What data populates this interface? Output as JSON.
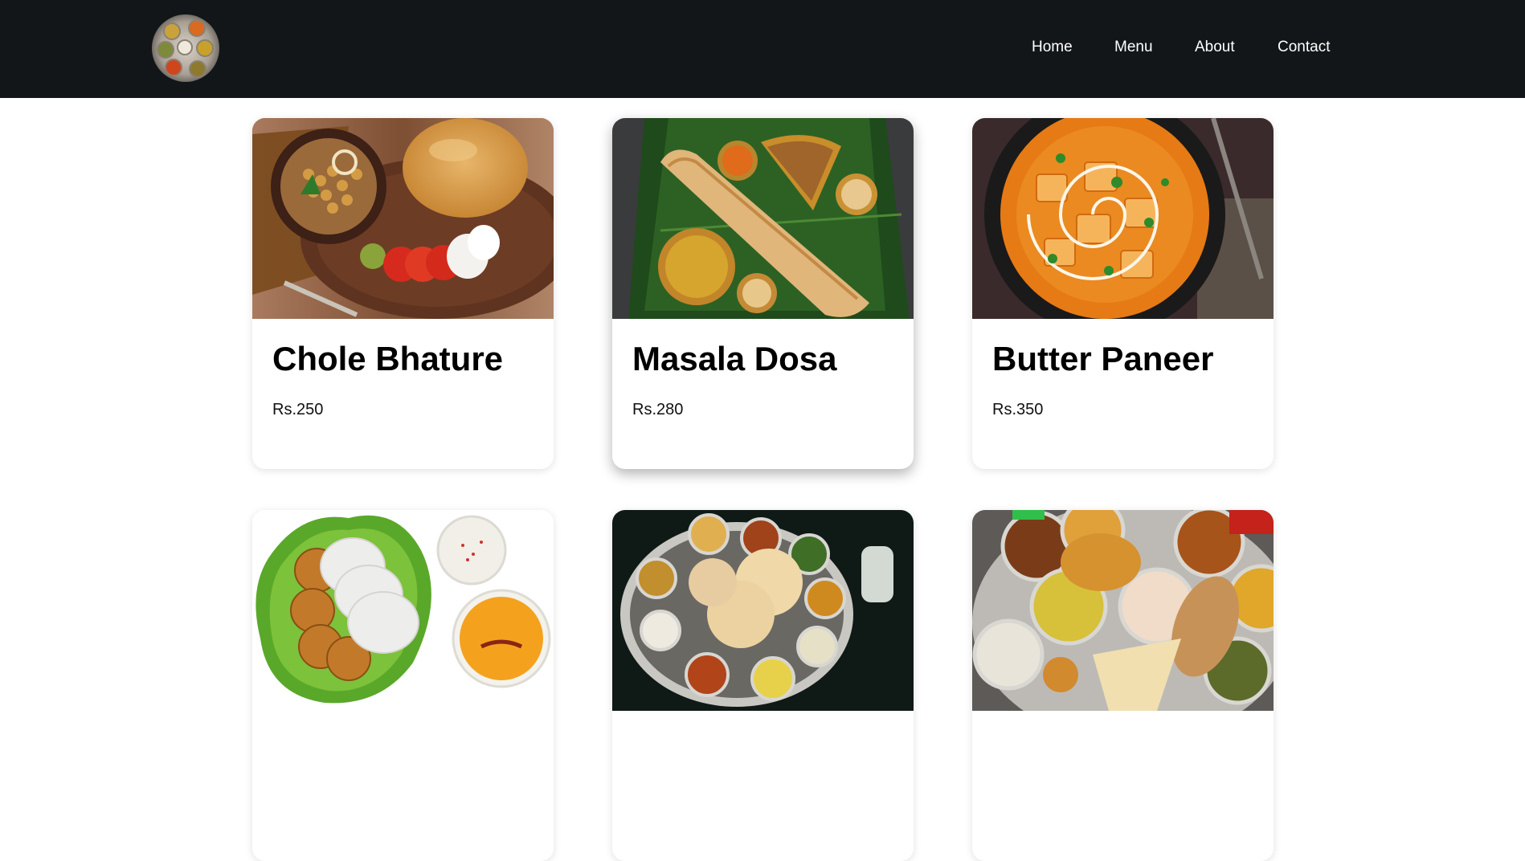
{
  "navbar": {
    "logo_icon": "thali-logo-icon",
    "links": [
      {
        "label": "Home"
      },
      {
        "label": "Menu"
      },
      {
        "label": "About"
      },
      {
        "label": "Contact"
      }
    ]
  },
  "menu": {
    "items": [
      {
        "name": "Chole Bhature",
        "price": "Rs.250",
        "image": "chole-bhature-photo"
      },
      {
        "name": "Masala Dosa",
        "price": "Rs.280",
        "image": "masala-dosa-photo"
      },
      {
        "name": "Butter Paneer",
        "price": "Rs.350",
        "image": "butter-paneer-photo"
      },
      {
        "name": "",
        "price": "",
        "image": "idli-vada-photo"
      },
      {
        "name": "",
        "price": "",
        "image": "thali-photo"
      },
      {
        "name": "",
        "price": "",
        "image": "maharashtrian-thali-photo"
      }
    ]
  },
  "colors": {
    "navbar_bg": "#121619",
    "nav_text": "#ffffff",
    "page_bg": "#ffffff"
  }
}
